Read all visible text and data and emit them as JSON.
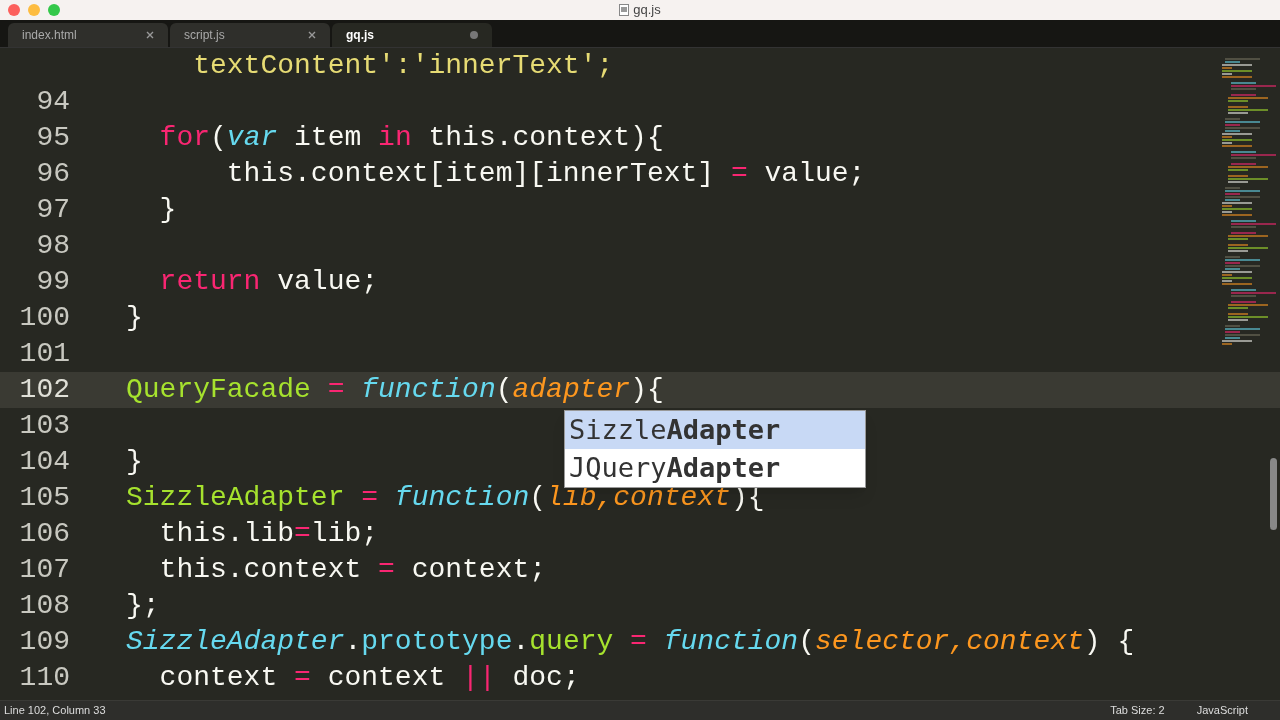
{
  "window": {
    "title": "gq.js"
  },
  "tabs": [
    {
      "label": "index.html",
      "selected": false,
      "modified": false
    },
    {
      "label": "script.js",
      "selected": false,
      "modified": false
    },
    {
      "label": "gq.js",
      "selected": true,
      "modified": true
    }
  ],
  "editor": {
    "lines": [
      {
        "current": false,
        "tokens": [
          {
            "kind": "string",
            "text": "    textContent':'innerText';"
          }
        ]
      },
      {
        "number": "94",
        "current": false
      },
      {
        "number": "95",
        "current": false,
        "tokens": [
          {
            "kind": "keyword",
            "text": "  for"
          },
          {
            "kind": "plain",
            "text": "("
          },
          {
            "kind": "storage",
            "text": "var"
          },
          {
            "kind": "plain",
            "text": " item "
          },
          {
            "kind": "keyword",
            "text": "in"
          },
          {
            "kind": "plain",
            "text": " this.context){"
          }
        ]
      },
      {
        "number": "96",
        "current": false,
        "tokens": [
          {
            "kind": "plain",
            "text": "      this.context[item][innerText] "
          },
          {
            "kind": "keyword",
            "text": "="
          },
          {
            "kind": "plain",
            "text": " value;"
          }
        ]
      },
      {
        "number": "97",
        "current": false,
        "tokens": [
          {
            "kind": "plain",
            "text": "  }"
          }
        ]
      },
      {
        "number": "98",
        "current": false
      },
      {
        "number": "99",
        "current": false,
        "tokens": [
          {
            "kind": "keyword",
            "text": "  return"
          },
          {
            "kind": "plain",
            "text": " value;"
          }
        ]
      },
      {
        "number": "100",
        "current": false,
        "tokens": [
          {
            "kind": "plain",
            "text": "}"
          }
        ]
      },
      {
        "number": "101",
        "current": false
      },
      {
        "number": "102",
        "current": true,
        "tokens": [
          {
            "kind": "name",
            "text": "QueryFacade"
          },
          {
            "kind": "keyword",
            "text": " = "
          },
          {
            "kind": "storage",
            "text": "function"
          },
          {
            "kind": "plain",
            "text": "("
          },
          {
            "kind": "param",
            "text": "adapter"
          },
          {
            "kind": "plain",
            "text": "){"
          }
        ]
      },
      {
        "number": "103",
        "current": false
      },
      {
        "number": "104",
        "current": false,
        "tokens": [
          {
            "kind": "plain",
            "text": "}"
          }
        ]
      },
      {
        "number": "105",
        "current": false,
        "tokens": [
          {
            "kind": "name",
            "text": "SizzleAdapter"
          },
          {
            "kind": "keyword",
            "text": " = "
          },
          {
            "kind": "storage",
            "text": "function"
          },
          {
            "kind": "plain",
            "text": "("
          },
          {
            "kind": "param",
            "text": "lib,context"
          },
          {
            "kind": "plain",
            "text": "){"
          }
        ]
      },
      {
        "number": "106",
        "current": false,
        "tokens": [
          {
            "kind": "plain",
            "text": "  this.lib"
          },
          {
            "kind": "keyword",
            "text": "="
          },
          {
            "kind": "plain",
            "text": "lib;"
          }
        ]
      },
      {
        "number": "107",
        "current": false,
        "tokens": [
          {
            "kind": "plain",
            "text": "  this.context "
          },
          {
            "kind": "keyword",
            "text": "="
          },
          {
            "kind": "plain",
            "text": " context;"
          }
        ]
      },
      {
        "number": "108",
        "current": false,
        "tokens": [
          {
            "kind": "plain",
            "text": "};"
          }
        ]
      },
      {
        "number": "109",
        "current": false,
        "tokens": [
          {
            "kind": "storage",
            "text": "SizzleAdapter"
          },
          {
            "kind": "plain",
            "text": "."
          },
          {
            "kind": "support",
            "text": "prototype"
          },
          {
            "kind": "plain",
            "text": "."
          },
          {
            "kind": "name",
            "text": "query"
          },
          {
            "kind": "keyword",
            "text": " = "
          },
          {
            "kind": "storage",
            "text": "function"
          },
          {
            "kind": "plain",
            "text": "("
          },
          {
            "kind": "param",
            "text": "selector,context"
          },
          {
            "kind": "plain",
            "text": ") {"
          }
        ]
      },
      {
        "number": "110",
        "current": false,
        "tokens": [
          {
            "kind": "plain",
            "text": "  context "
          },
          {
            "kind": "keyword",
            "text": "="
          },
          {
            "kind": "plain",
            "text": " context "
          },
          {
            "kind": "keyword",
            "text": "||"
          },
          {
            "kind": "plain",
            "text": " doc;"
          }
        ]
      }
    ]
  },
  "autocomplete": [
    {
      "text": "Sizzle**Adapter**",
      "selected": true
    },
    {
      "text": "JQuery**Adapter**",
      "selected": false
    }
  ],
  "status_bar": {
    "position": "Line 102, Column 33",
    "tab_size": "Tab Size: 2",
    "syntax": "JavaScript"
  }
}
